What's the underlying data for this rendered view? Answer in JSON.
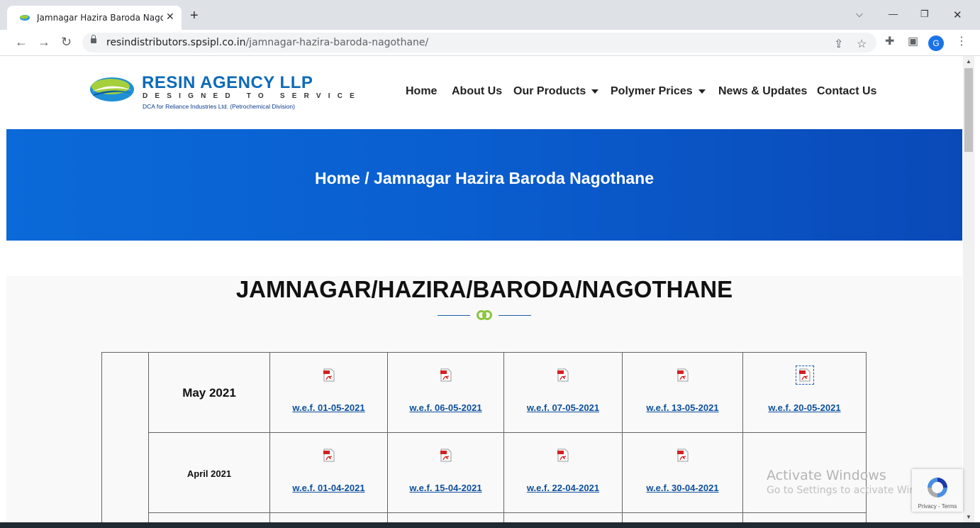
{
  "browser": {
    "tab_title": "Jamnagar Hazira Baroda Nagothane",
    "url_host": "resindistributors.spsipl.co.in",
    "url_path": "/jamnagar-hazira-baroda-nagothane/",
    "avatar_letter": "G"
  },
  "site": {
    "brand": "RESIN AGENCY LLP",
    "tagline": "DESIGNED TO SERVICE",
    "subtagline": "DCA for Reliance Industries Ltd. (Petrochemical Division)",
    "nav": [
      {
        "label": "Home"
      },
      {
        "label": "About Us"
      },
      {
        "label": "Our Products"
      },
      {
        "label": "Polymer Prices"
      },
      {
        "label": "News & Updates"
      },
      {
        "label": "Contact Us"
      }
    ]
  },
  "hero": {
    "breadcrumb": "Home / Jamnagar Hazira Baroda Nagothane"
  },
  "content": {
    "heading": "JAMNAGAR/HAZIRA/BARODA/NAGOTHANE",
    "rows": [
      {
        "month": "May 2021",
        "links": [
          "w.e.f. 01-05-2021",
          "w.e.f. 06-05-2021",
          "w.e.f. 07-05-2021",
          "w.e.f. 13-05-2021",
          "w.e.f. 20-05-2021"
        ]
      },
      {
        "month": "April 2021",
        "links": [
          "w.e.f. 01-04-2021",
          "w.e.f. 15-04-2021",
          "w.e.f. 22-04-2021",
          "w.e.f. 30-04-2021"
        ]
      }
    ]
  },
  "overlays": {
    "activate_title": "Activate Windows",
    "activate_sub": "Go to Settings to activate Windows.",
    "recaptcha_links": "Privacy - Terms"
  },
  "colors": {
    "brand_blue": "#0d6ab8",
    "hero_blue": "#0a5fd0",
    "link_blue": "#0d4f9c",
    "accent_green": "#8cc63f"
  }
}
